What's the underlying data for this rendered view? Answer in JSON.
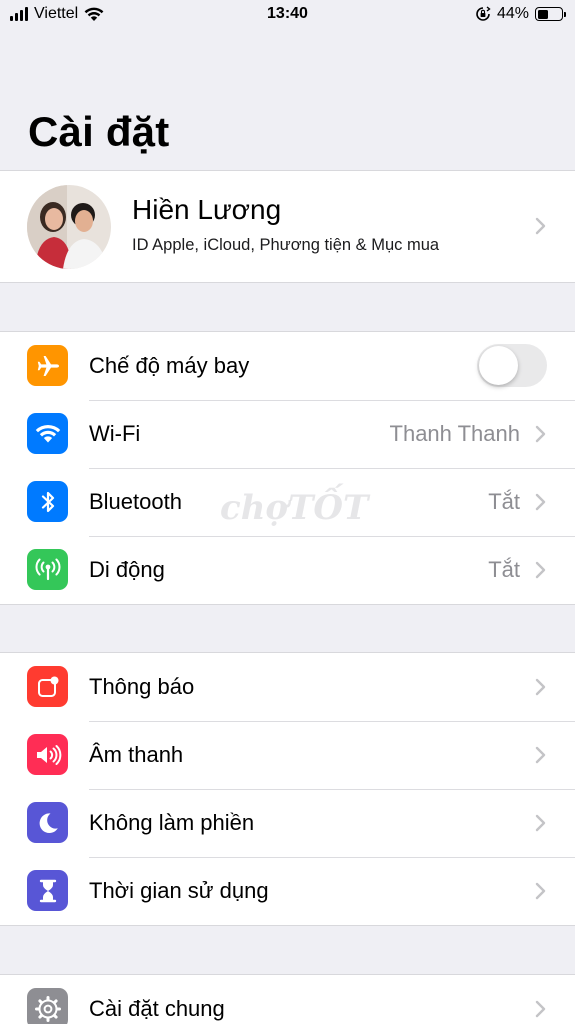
{
  "status_bar": {
    "carrier": "Viettel",
    "time": "13:40",
    "battery_percent": "44%",
    "battery_level": 0.44,
    "icons": [
      "signal-icon",
      "wifi-icon",
      "orientation-lock-icon",
      "battery-icon"
    ]
  },
  "page_title": "Cài đặt",
  "profile": {
    "name": "Hiền Lương",
    "subtitle": "ID Apple, iCloud, Phương tiện & Mục mua"
  },
  "watermark": "chợTỐT",
  "groups": [
    {
      "items": [
        {
          "label": "Chế độ máy bay",
          "icon": "airplane-icon",
          "color": "#ff9500",
          "toggle": false
        },
        {
          "label": "Wi-Fi",
          "icon": "wifi-icon",
          "color": "#007aff",
          "value": "Thanh Thanh"
        },
        {
          "label": "Bluetooth",
          "icon": "bluetooth-icon",
          "color": "#007aff",
          "value": "Tắt"
        },
        {
          "label": "Di động",
          "icon": "cellular-icon",
          "color": "#34c759",
          "value": "Tắt"
        }
      ]
    },
    {
      "items": [
        {
          "label": "Thông báo",
          "icon": "notifications-icon",
          "color": "#ff3b30"
        },
        {
          "label": "Âm thanh",
          "icon": "sound-icon",
          "color": "#ff2d55"
        },
        {
          "label": "Không làm phiền",
          "icon": "moon-icon",
          "color": "#5856d6"
        },
        {
          "label": "Thời gian sử dụng",
          "icon": "hourglass-icon",
          "color": "#5856d6"
        }
      ]
    },
    {
      "items": [
        {
          "label": "Cài đặt chung",
          "icon": "gear-icon",
          "color": "#8e8e93"
        }
      ]
    }
  ]
}
